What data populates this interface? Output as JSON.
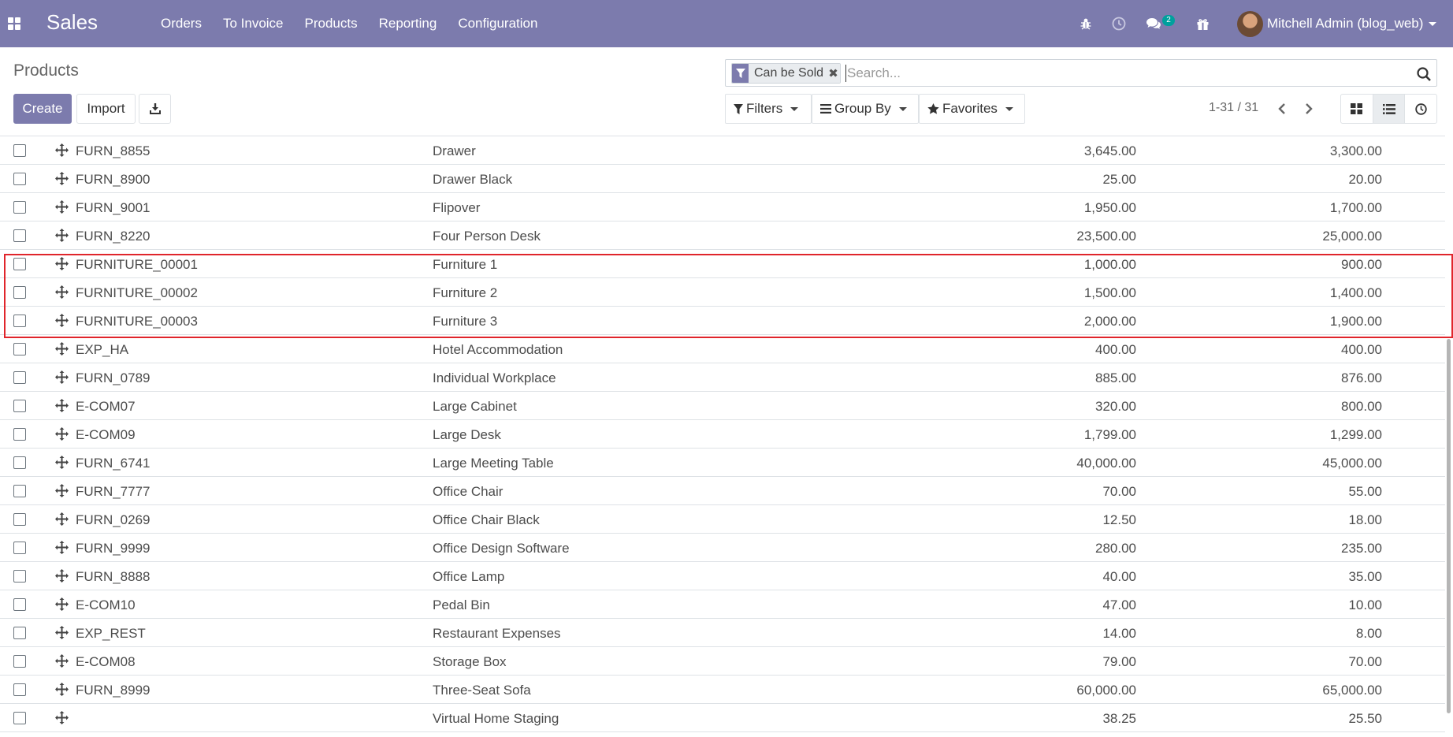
{
  "navbar": {
    "brand": "Sales",
    "menu": [
      "Orders",
      "To Invoice",
      "Products",
      "Reporting",
      "Configuration"
    ],
    "messages_badge": "2",
    "user": "Mitchell Admin (blog_web)",
    "color": "#7c7bad"
  },
  "control": {
    "title": "Products",
    "create_label": "Create",
    "import_label": "Import",
    "download_icon": "download-icon"
  },
  "search": {
    "facet_label": "Can be Sold",
    "placeholder": "Search..."
  },
  "filters": {
    "filters_label": "Filters",
    "groupby_label": "Group By",
    "favorites_label": "Favorites"
  },
  "pager": {
    "value": "1-31 / 31"
  },
  "products": [
    {
      "ref": "FURN_8855",
      "name": "Drawer",
      "price": "3,645.00",
      "cost": "3,300.00"
    },
    {
      "ref": "FURN_8900",
      "name": "Drawer Black",
      "price": "25.00",
      "cost": "20.00"
    },
    {
      "ref": "FURN_9001",
      "name": "Flipover",
      "price": "1,950.00",
      "cost": "1,700.00"
    },
    {
      "ref": "FURN_8220",
      "name": "Four Person Desk",
      "price": "23,500.00",
      "cost": "25,000.00"
    },
    {
      "ref": "FURNITURE_00001",
      "name": "Furniture 1",
      "price": "1,000.00",
      "cost": "900.00"
    },
    {
      "ref": "FURNITURE_00002",
      "name": "Furniture 2",
      "price": "1,500.00",
      "cost": "1,400.00"
    },
    {
      "ref": "FURNITURE_00003",
      "name": "Furniture 3",
      "price": "2,000.00",
      "cost": "1,900.00"
    },
    {
      "ref": "EXP_HA",
      "name": "Hotel Accommodation",
      "price": "400.00",
      "cost": "400.00"
    },
    {
      "ref": "FURN_0789",
      "name": "Individual Workplace",
      "price": "885.00",
      "cost": "876.00"
    },
    {
      "ref": "E-COM07",
      "name": "Large Cabinet",
      "price": "320.00",
      "cost": "800.00"
    },
    {
      "ref": "E-COM09",
      "name": "Large Desk",
      "price": "1,799.00",
      "cost": "1,299.00"
    },
    {
      "ref": "FURN_6741",
      "name": "Large Meeting Table",
      "price": "40,000.00",
      "cost": "45,000.00"
    },
    {
      "ref": "FURN_7777",
      "name": "Office Chair",
      "price": "70.00",
      "cost": "55.00"
    },
    {
      "ref": "FURN_0269",
      "name": "Office Chair Black",
      "price": "12.50",
      "cost": "18.00"
    },
    {
      "ref": "FURN_9999",
      "name": "Office Design Software",
      "price": "280.00",
      "cost": "235.00"
    },
    {
      "ref": "FURN_8888",
      "name": "Office Lamp",
      "price": "40.00",
      "cost": "35.00"
    },
    {
      "ref": "E-COM10",
      "name": "Pedal Bin",
      "price": "47.00",
      "cost": "10.00"
    },
    {
      "ref": "EXP_REST",
      "name": "Restaurant Expenses",
      "price": "14.00",
      "cost": "8.00"
    },
    {
      "ref": "E-COM08",
      "name": "Storage Box",
      "price": "79.00",
      "cost": "70.00"
    },
    {
      "ref": "FURN_8999",
      "name": "Three-Seat Sofa",
      "price": "60,000.00",
      "cost": "65,000.00"
    },
    {
      "ref": "",
      "name": "Virtual Home Staging",
      "price": "38.25",
      "cost": "25.50"
    }
  ],
  "highlight_color": "#e0252b"
}
